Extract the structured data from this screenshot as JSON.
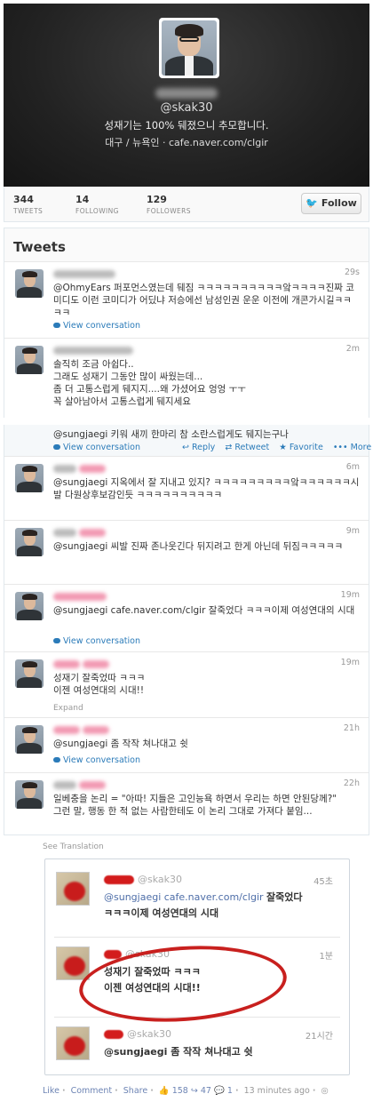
{
  "profile": {
    "display_name": "김○○",
    "handle": "@skak30",
    "bio": "성재기는 100% 뒈졌으니 추모합니다.",
    "location": "대구 / 뉴욕인",
    "link": "cafe.naver.com/clgir"
  },
  "stats": [
    {
      "num": "344",
      "label": "TWEETS"
    },
    {
      "num": "14",
      "label": "FOLLOWING"
    },
    {
      "num": "129",
      "label": "FOLLOWERS"
    }
  ],
  "follow_label": "Follow",
  "tweets_title": "Tweets",
  "tweets_top": [
    {
      "name": "김○○",
      "time": "29s",
      "text": "@OhmyEars 퍼포먼스였는데 뒈짐 ㅋㅋㅋㅋㅋㅋㅋㅋㅋㅋ앜ㅋㅋㅋㅋ진짜 코미디도 이런 코미디가 어딨냐 저승에선 남성인권 운운 이전에 개콘가시길ㅋㅋㅋㅋ",
      "link": "View conversation"
    },
    {
      "name": "김○○",
      "handle": "@skak30",
      "time": "2m",
      "text": "솔직히 조금 아쉽다..\n그래도 성재기 그동안 많이 싸웠는데...\n좀 더 고통스럽게 뒈지지....왜 가셨어요 엉엉 ㅜㅜ\n꼭 살아남아서 고통스럽게 뒈지세요"
    }
  ],
  "tweets_bottom": [
    {
      "text": "@sungjaegi 키워 새끼 한마리 참 소란스럽게도 뒈지는구나",
      "link": "View conversation",
      "actions": [
        "Reply",
        "Retweet",
        "Favorite",
        "More"
      ]
    },
    {
      "name": "김○○",
      "handle": "@skak30",
      "time": "6m",
      "text": "@sungjaegi 지옥에서 잘 지내고 있지? ㅋㅋㅋㅋㅋㅋㅋㅋㅋ앜ㅋㅋㅋㅋㅋㅋ시발 다원상후보감인듯 ㅋㅋㅋㅋㅋㅋㅋㅋㅋㅋ"
    },
    {
      "name": "김○○",
      "handle": "@skak30",
      "time": "9m",
      "text": "@sungjaegi 씨발 진짜 존나웃긴다 뒤지려고 한게 아닌데 뒤짐ㅋㅋㅋㅋㅋ"
    },
    {
      "name": "김○○",
      "handle": "@skak30",
      "time": "19m",
      "text": "@sungjaegi cafe.naver.com/clgir 잘죽었다 ㅋㅋㅋ이제 여성연대의 시대",
      "link": "View conversation"
    },
    {
      "name": "김○○",
      "handle": "@skak30",
      "time": "19m",
      "text": "성재기 잘죽었따 ㅋㅋㅋ\n이젠 여성연대의 시대!!",
      "expand": "Expand"
    },
    {
      "name": "김○○",
      "handle": "@skak30",
      "time": "21h",
      "text": "@sungjaegi 좀 작작 쳐나대고 쉿",
      "link": "View conversation"
    },
    {
      "name": "김○○",
      "handle": "@skak30",
      "time": "22h",
      "text": "일베충을 논리 = \"아따! 지들은 고인능욕 하면서 우리는 하면 안된당께?\"\n그런 말, 행동 한 적 없는 사람한테도 이 논리 그대로 가져다 붙임..."
    }
  ],
  "fb": {
    "see_translation": "See Translation",
    "items": [
      {
        "handle": "@skak30",
        "time": "45초",
        "link": "@sungjaegi cafe.naver.com/clgir",
        "text_after": "잘죽었다",
        "text2": "ㅋㅋㅋ이제 여성연대의 시대"
      },
      {
        "handle": "@skak30",
        "time": "1분",
        "text": "성재기 잘죽었따 ㅋㅋㅋ",
        "text2": "이젠 여성연대의 시대!!"
      },
      {
        "handle": "@skak30",
        "time": "21시간",
        "text": "@sungjaegi 좀 작작 쳐나대고 쉿"
      }
    ],
    "footer": {
      "like": "Like",
      "comment": "Comment",
      "share": "Share",
      "likes": "158",
      "shares": "47",
      "comments": "1",
      "time": "13 minutes ago"
    }
  }
}
